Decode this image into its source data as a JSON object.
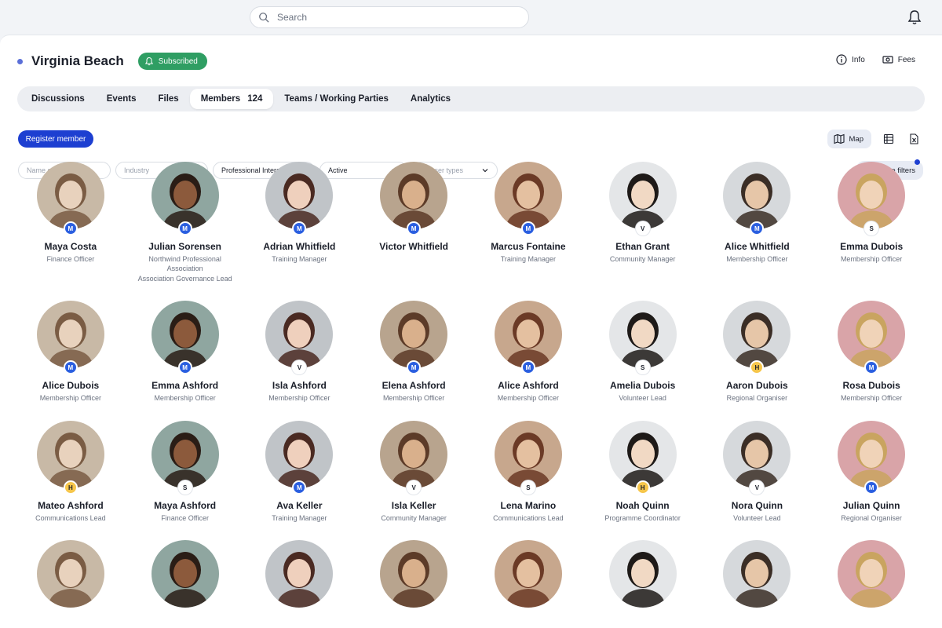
{
  "topbar": {
    "search_placeholder": "Search"
  },
  "header": {
    "title": "Virginia Beach",
    "subscribed_label": "Subscribed",
    "actions": {
      "info": "Info",
      "fees": "Fees"
    }
  },
  "tabs": [
    {
      "label": "Discussions"
    },
    {
      "label": "Events"
    },
    {
      "label": "Files"
    },
    {
      "label": "Members",
      "count": "124",
      "active": true
    },
    {
      "label": "Teams / Working Parties"
    },
    {
      "label": "Analytics"
    }
  ],
  "toolbar": {
    "register_label": "Register member",
    "map_label": "Map",
    "more_filters_label": "More filters"
  },
  "filters": {
    "name_placeholder": "Name or Keyword",
    "industry_placeholder": "Industry",
    "interests_value": "Professional Interests",
    "status_value": "Active",
    "user_types_placeholder": "All user types"
  },
  "colors": {
    "accent": "#1d3fd1",
    "subscribed": "#2f9e63",
    "badge_M": "#2b5fe0",
    "badge_H": "#f6c64b"
  },
  "members": [
    {
      "name": "Maya Costa",
      "role": "Finance Officer",
      "badge": "M"
    },
    {
      "name": "Julian Sorensen",
      "role": "Northwind Professional Association",
      "role2": "Association Governance Lead",
      "badge": "M"
    },
    {
      "name": "Adrian Whitfield",
      "role": "Training Manager",
      "badge": "M"
    },
    {
      "name": "Victor Whitfield",
      "role": "",
      "badge": "M"
    },
    {
      "name": "Marcus Fontaine",
      "role": "Training Manager",
      "badge": "M"
    },
    {
      "name": "Ethan Grant",
      "role": "Community Manager",
      "badge": "V"
    },
    {
      "name": "Alice Whitfield",
      "role": "Membership Officer",
      "badge": "M"
    },
    {
      "name": "Emma Dubois",
      "role": "Membership Officer",
      "badge": "S"
    },
    {
      "name": "Alice Dubois",
      "role": "Membership Officer",
      "badge": "M"
    },
    {
      "name": "Emma Ashford",
      "role": "Membership Officer",
      "badge": "M"
    },
    {
      "name": "Isla Ashford",
      "role": "Membership Officer",
      "badge": "V"
    },
    {
      "name": "Elena Ashford",
      "role": "Membership Officer",
      "badge": "M"
    },
    {
      "name": "Alice Ashford",
      "role": "Membership Officer",
      "badge": "M"
    },
    {
      "name": "Amelia Dubois",
      "role": "Volunteer Lead",
      "badge": "S"
    },
    {
      "name": "Aaron Dubois",
      "role": "Regional Organiser",
      "badge": "H"
    },
    {
      "name": "Rosa Dubois",
      "role": "Membership Officer",
      "badge": "M"
    },
    {
      "name": "Mateo Ashford",
      "role": "Communications Lead",
      "badge": "H"
    },
    {
      "name": "Maya Ashford",
      "role": "Finance Officer",
      "badge": "S"
    },
    {
      "name": "Ava Keller",
      "role": "Training Manager",
      "badge": "M"
    },
    {
      "name": "Isla Keller",
      "role": "Community Manager",
      "badge": "V"
    },
    {
      "name": "Lena Marino",
      "role": "Communications Lead",
      "badge": "S"
    },
    {
      "name": "Noah Quinn",
      "role": "Programme Coordinator",
      "badge": "H"
    },
    {
      "name": "Nora Quinn",
      "role": "Volunteer Lead",
      "badge": "V"
    },
    {
      "name": "Julian Quinn",
      "role": "Regional Organiser",
      "badge": "M"
    },
    {
      "name": "",
      "role": ""
    },
    {
      "name": "",
      "role": ""
    },
    {
      "name": "",
      "role": ""
    },
    {
      "name": "",
      "role": ""
    },
    {
      "name": "",
      "role": ""
    },
    {
      "name": "",
      "role": ""
    },
    {
      "name": "",
      "role": ""
    },
    {
      "name": "",
      "role": ""
    }
  ]
}
